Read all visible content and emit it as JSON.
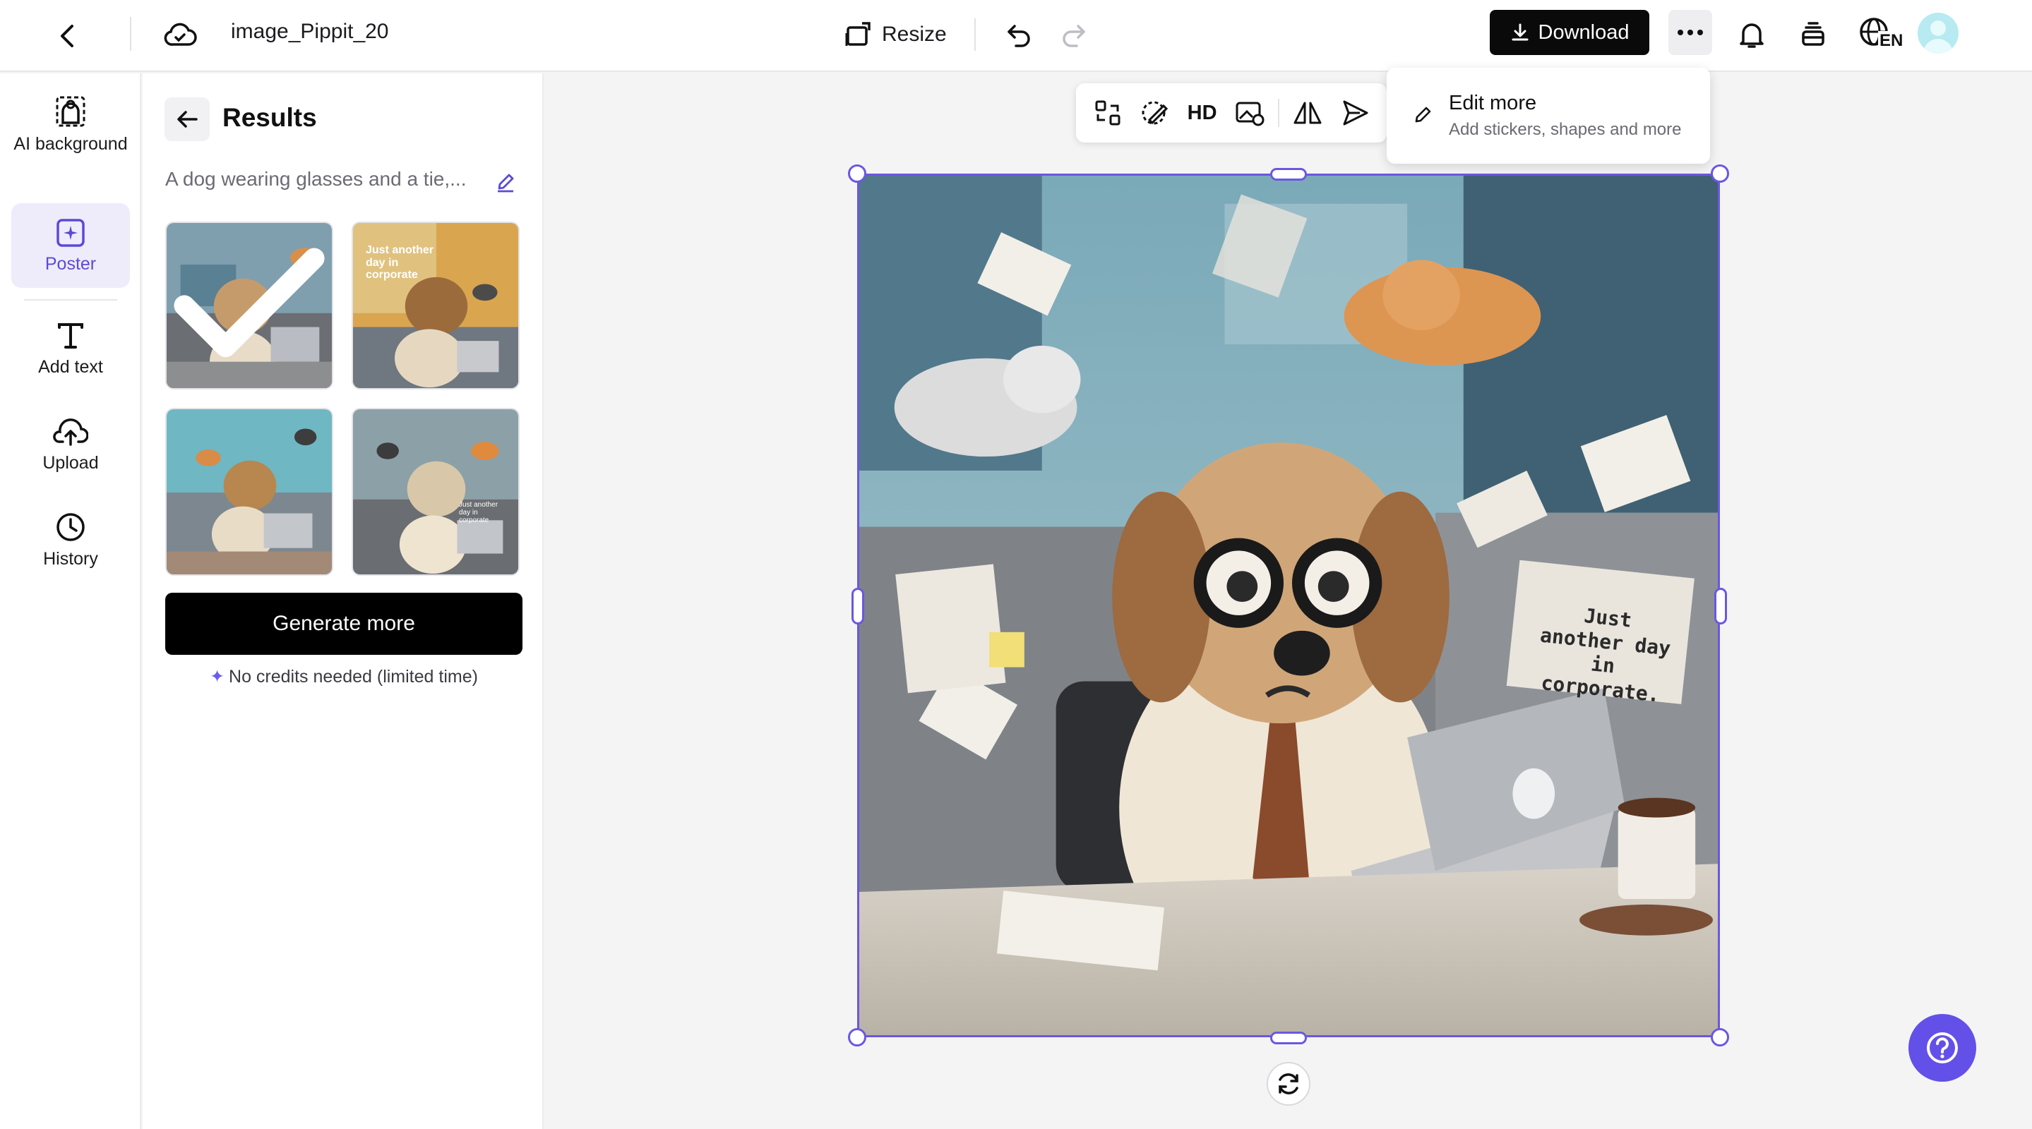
{
  "header": {
    "file_name": "image_Pippit_20",
    "resize_label": "Resize",
    "download_label": "Download",
    "language_code": "EN"
  },
  "rail": {
    "items": [
      {
        "label": "AI background",
        "icon": "ai-background-icon"
      },
      {
        "label": "Poster",
        "icon": "poster-icon",
        "active": true
      },
      {
        "label": "Add text",
        "icon": "text-icon"
      },
      {
        "label": "Upload",
        "icon": "upload-icon"
      },
      {
        "label": "History",
        "icon": "history-icon"
      }
    ]
  },
  "results": {
    "title": "Results",
    "prompt": "A dog wearing glasses and a tie,...",
    "generate_label": "Generate more",
    "credits_note": "No credits needed (limited time)",
    "thumb_texts": [
      "Just another day in corporate",
      "Just another day in corporate"
    ]
  },
  "canvas_toolbar": {
    "hd_label": "HD"
  },
  "edit_more": {
    "title": "Edit more",
    "subtitle": "Add stickers, shapes and more"
  },
  "image": {
    "sign_text": "Just another day in corporate."
  },
  "colors": {
    "accent": "#6a58e0",
    "help": "#6350e8",
    "download_bg": "#0a0a0a"
  }
}
